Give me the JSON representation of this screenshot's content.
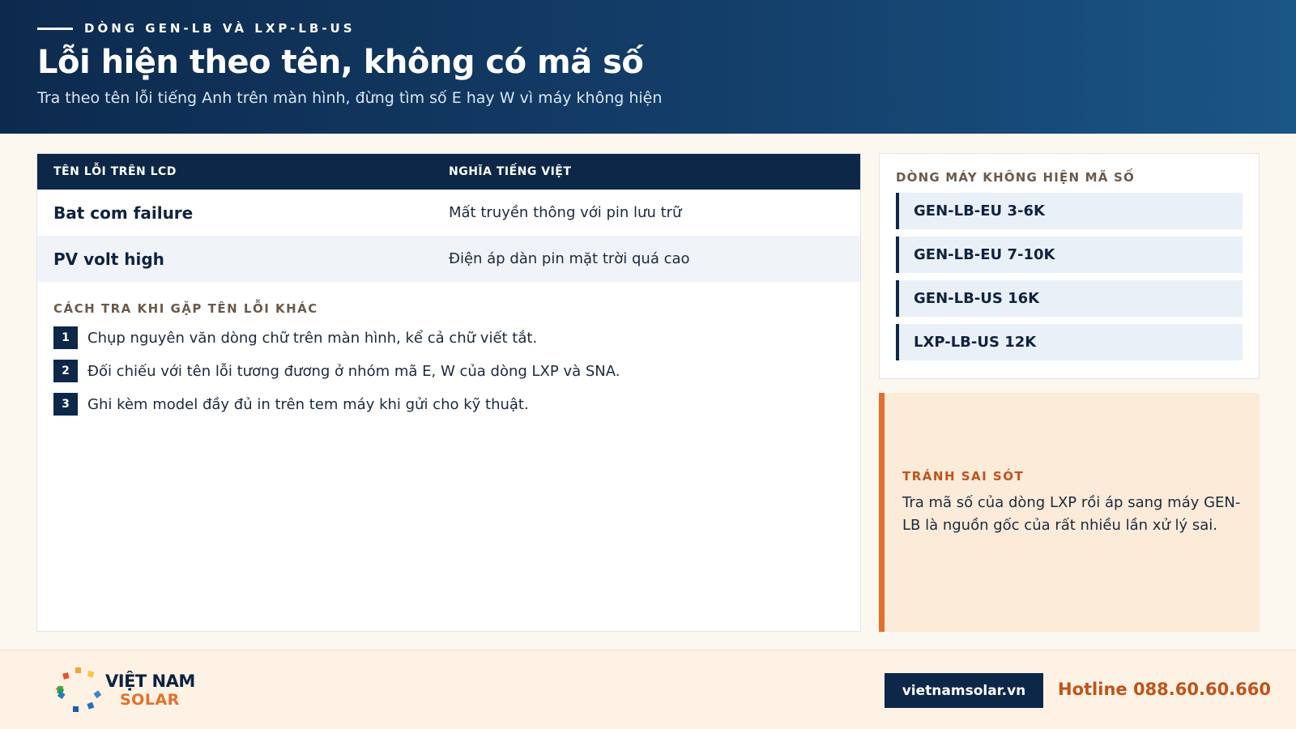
{
  "header": {
    "eyebrow": "DÒNG GEN-LB VÀ LXP-LB-US",
    "title": "Lỗi hiện theo tên, không có mã số",
    "subtitle": "Tra theo tên lỗi tiếng Anh trên màn hình, đừng tìm số E hay W vì máy không hiện"
  },
  "table": {
    "headers": [
      "TÊN LỖI TRÊN LCD",
      "NGHĨA TIẾNG VIỆT"
    ],
    "rows": [
      {
        "name": "Bat com failure",
        "meaning": "Mất truyền thông với pin lưu trữ"
      },
      {
        "name": "PV volt high",
        "meaning": "Điện áp dàn pin mặt trời quá cao"
      }
    ]
  },
  "steps": {
    "label": "CÁCH TRA KHI GẶP TÊN LỖI KHÁC",
    "items": [
      {
        "num": "1",
        "text": "Chụp nguyên văn dòng chữ trên màn hình, kể cả chữ viết tắt."
      },
      {
        "num": "2",
        "text": "Đối chiếu với tên lỗi tương đương ở nhóm mã E, W của dòng LXP và SNA."
      },
      {
        "num": "3",
        "text": "Ghi kèm model đầy đủ in trên tem máy khi gửi cho kỹ thuật."
      }
    ]
  },
  "models": {
    "label": "DÒNG MÁY KHÔNG HIỆN MÃ SỐ",
    "items": [
      "GEN-LB-EU 3-6K",
      "GEN-LB-EU 7-10K",
      "GEN-LB-US 16K",
      "LXP-LB-US 12K"
    ]
  },
  "warning": {
    "label": "TRÁNH SAI SÓT",
    "text": "Tra mã số của dòng LXP rồi áp sang máy GEN-LB là nguồn gốc của rất nhiều lần xử lý sai."
  },
  "footer": {
    "logo_line1": "VIỆT NAM",
    "logo_line2": "SOLAR",
    "website": "vietnamsolar.vn",
    "hotline": "Hotline 088.60.60.660"
  },
  "colors": {
    "navy": "#0d2748",
    "accent_orange": "#e2702b",
    "background": "#fdf8ef"
  }
}
